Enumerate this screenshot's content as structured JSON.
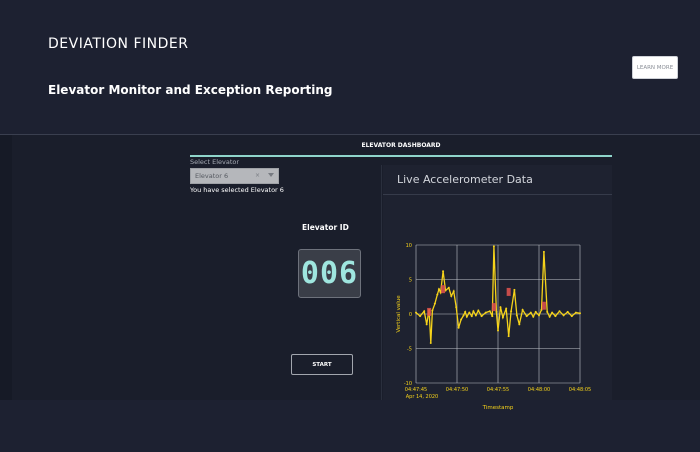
{
  "header": {
    "title": "DEVIATION FINDER",
    "subtitle": "Elevator Monitor and Exception Reporting",
    "learn_more_label": "LEARN MORE"
  },
  "dashboard": {
    "tab_label": "ELEVATOR DASHBOARD",
    "select_label": "Select Elevator",
    "selected_value": "Elevator 6",
    "clear_glyph": "×",
    "selected_text": "You have selected Elevator 6",
    "elevator_id_label": "Elevator ID",
    "elevator_id_value": "006",
    "start_label": "START"
  },
  "chart_panel": {
    "title": "Live Accelerometer Data"
  },
  "colors": {
    "line": "#f6d31a",
    "anomaly": "#e4534f",
    "accent": "#8fd5cb"
  },
  "chart_data": {
    "type": "line",
    "title": "",
    "xlabel": "Timestamp",
    "ylabel": "Vertical value",
    "x_ticks": [
      "04:47:45",
      "04:47:50",
      "04:47:55",
      "04:48:00",
      "04:48:05"
    ],
    "x_date_label": "Apr 14, 2020",
    "y_ticks": [
      -10,
      -5,
      0,
      5,
      10
    ],
    "ylim": [
      -10,
      10
    ],
    "xlim_seconds": [
      0,
      20
    ],
    "grid": true,
    "series": [
      {
        "x": [
          0,
          0.5,
          1,
          1.3,
          1.6,
          1.8,
          2,
          2.3,
          2.6,
          2.8,
          3,
          3.3,
          3.6,
          4,
          4.3,
          4.6,
          4.9,
          5.2,
          5.5,
          5.8,
          6,
          6.2,
          6.5,
          6.8,
          7,
          7.3,
          7.6,
          8,
          8.5,
          9,
          9.3,
          9.5,
          9.8,
          10,
          10.3,
          10.6,
          11,
          11.3,
          11.6,
          12,
          12.3,
          12.6,
          13,
          13.5,
          14,
          14.3,
          14.6,
          15,
          15.3,
          15.6,
          16,
          16.3,
          16.6,
          17,
          17.5,
          18,
          18.5,
          19,
          19.5,
          20
        ],
        "y": [
          0.2,
          -0.3,
          0.4,
          -1.5,
          0.6,
          -4.2,
          0.5,
          1.5,
          2.8,
          3.6,
          3.1,
          6.2,
          3.4,
          3.8,
          2.6,
          3.3,
          1.0,
          -2.0,
          -0.8,
          -0.2,
          0.3,
          -0.4,
          0.2,
          -0.3,
          0.4,
          -0.2,
          0.5,
          -0.3,
          0.2,
          0.4,
          -0.3,
          9.8,
          0.3,
          -2.4,
          1.0,
          -0.5,
          0.8,
          -3.2,
          0.4,
          3.5,
          -0.2,
          -1.5,
          0.6,
          -0.3,
          0.2,
          -0.4,
          0.3,
          -0.2,
          0.6,
          9.0,
          0.3,
          -0.4,
          0.2,
          -0.3,
          0.4,
          -0.2,
          0.3,
          -0.3,
          0.2,
          0.1
        ]
      }
    ],
    "anomalies": [
      {
        "x": 1.6,
        "y": 0.3
      },
      {
        "x": 3.3,
        "y": 3.6
      },
      {
        "x": 9.5,
        "y": 1.0
      },
      {
        "x": 11.3,
        "y": 3.2
      },
      {
        "x": 15.6,
        "y": 1.2
      }
    ]
  }
}
